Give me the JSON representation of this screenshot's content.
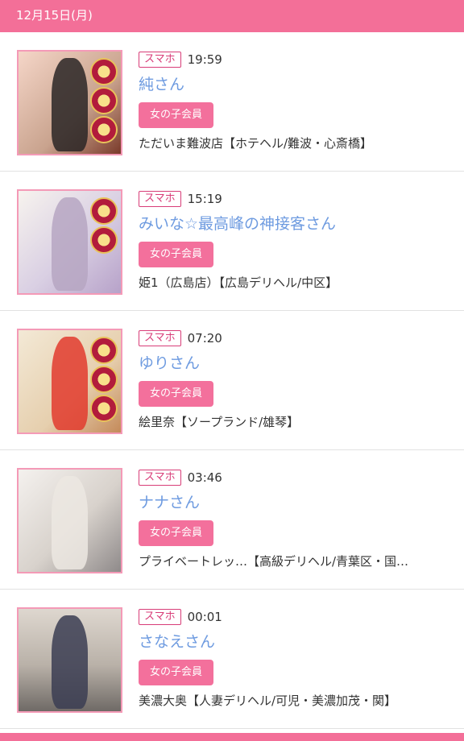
{
  "header": {
    "date": "12月15日(月)"
  },
  "colors": {
    "accent": "#f36f98",
    "name_link": "#6e9be0",
    "tag": "#d83d78",
    "thumb_border": "#f49ab7"
  },
  "entries": [
    {
      "device": "スマホ",
      "time": "19:59",
      "name": "純さん",
      "member_label": "女の子会員",
      "shop": "ただいま難波店【ホテヘル/難波・心斎橋】"
    },
    {
      "device": "スマホ",
      "time": "15:19",
      "name": "みいな☆最高峰の神接客さん",
      "member_label": "女の子会員",
      "shop": "姫1（広島店）【広島デリヘル/中区】"
    },
    {
      "device": "スマホ",
      "time": "07:20",
      "name": "ゆりさん",
      "member_label": "女の子会員",
      "shop": "絵里奈【ソープランド/雄琴】"
    },
    {
      "device": "スマホ",
      "time": "03:46",
      "name": "ナナさん",
      "member_label": "女の子会員",
      "shop": "プライベートレッ…【高級デリヘル/青葉区・国…"
    },
    {
      "device": "スマホ",
      "time": "00:01",
      "name": "さなえさん",
      "member_label": "女の子会員",
      "shop": "美濃大奥【人妻デリヘル/可児・美濃加茂・関】"
    }
  ]
}
